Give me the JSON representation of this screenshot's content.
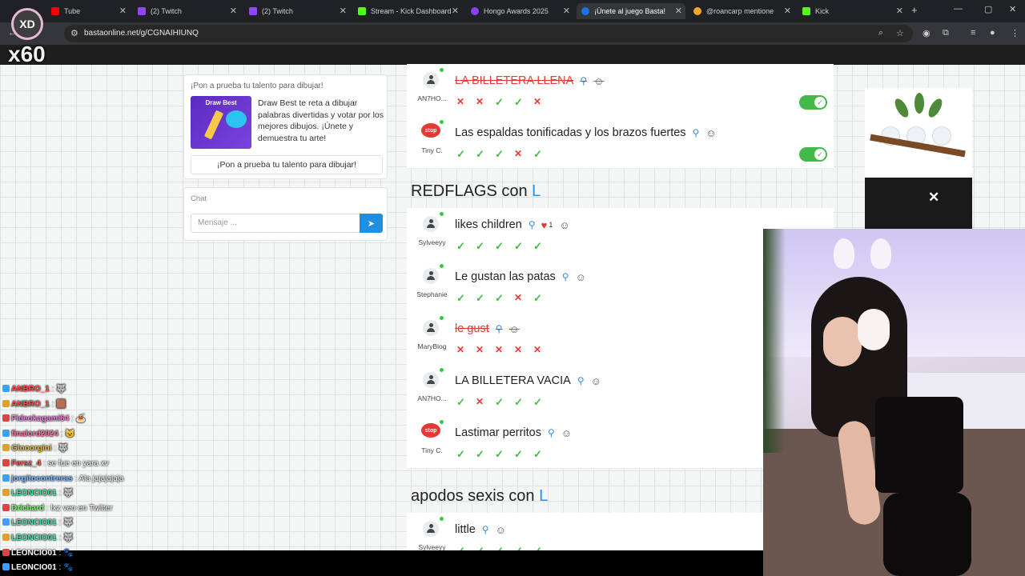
{
  "browser": {
    "tabs": [
      {
        "label": "Tube",
        "icon": "youtube-icon"
      },
      {
        "label": "(2) Twitch",
        "icon": "twitch-icon"
      },
      {
        "label": "(2) Twitch",
        "icon": "twitch-icon"
      },
      {
        "label": "Stream - Kick Dashboard",
        "icon": "kick-icon"
      },
      {
        "label": "Hongo Awards 2025",
        "icon": "hongo-icon"
      },
      {
        "label": "¡Únete al juego Basta!",
        "icon": "basta-icon"
      },
      {
        "label": "@roancarp mentione",
        "icon": "bell-icon"
      },
      {
        "label": "Kick",
        "icon": "kick-icon"
      }
    ],
    "url": "bastaonline.net/g/CGNAIHIUNQ"
  },
  "promo": {
    "title": "¡Pon a prueba tu talento para dibujar!",
    "image_caption": "Draw Best",
    "text": "Draw Best te reta a dibujar palabras divertidas y votar por los mejores dibujos. ¡Únete y demuestra tu arte!",
    "button": "¡Pon a prueba tu talento para dibujar!"
  },
  "chat": {
    "title": "Chat",
    "placeholder": "Mensaje ..."
  },
  "top_answers": [
    {
      "user": "AN7HO...",
      "avatar": "person",
      "text": "LA BILLETERA LLENA",
      "rejected": true,
      "votes": [
        "no",
        "no",
        "ok",
        "ok",
        "no"
      ],
      "toggle": "on"
    },
    {
      "user": "Tiny C.",
      "avatar": "stop",
      "text": "Las espaldas tonificadas y los brazos fuertes",
      "rejected": false,
      "votes": [
        "ok",
        "ok",
        "ok",
        "no",
        "ok"
      ],
      "toggle": "on"
    }
  ],
  "sections": [
    {
      "title": "REDFLAGS con",
      "letter": "L",
      "answers": [
        {
          "user": "Sylveeyy",
          "avatar": "person",
          "text": "likes children",
          "rejected": false,
          "hearts": "1",
          "votes": [
            "ok",
            "ok",
            "ok",
            "ok",
            "ok"
          ]
        },
        {
          "user": "Stephanie",
          "avatar": "person",
          "text": "Le gustan las patas",
          "rejected": false,
          "votes": [
            "ok",
            "ok",
            "ok",
            "no",
            "ok"
          ]
        },
        {
          "user": "MaryBlog",
          "avatar": "person",
          "text": "le gust",
          "rejected": true,
          "votes": [
            "no",
            "no",
            "no",
            "no",
            "no"
          ]
        },
        {
          "user": "AN7HO...",
          "avatar": "person",
          "text": "LA BILLETERA VACIA",
          "rejected": false,
          "votes": [
            "ok",
            "no",
            "ok",
            "ok",
            "ok"
          ]
        },
        {
          "user": "Tiny C.",
          "avatar": "stop",
          "text": "Lastimar perritos",
          "rejected": false,
          "votes": [
            "ok",
            "ok",
            "ok",
            "ok",
            "ok"
          ]
        }
      ]
    },
    {
      "title": "apodos sexis con",
      "letter": "L",
      "answers": [
        {
          "user": "Sylveeyy",
          "avatar": "person",
          "text": "little",
          "rejected": false,
          "votes": [
            "ok",
            "ok",
            "ok",
            "ok",
            "ok"
          ]
        }
      ]
    }
  ],
  "stream_overlay": {
    "logo_text": "XD",
    "multiplier": "x60",
    "chat_lines": [
      {
        "user": "ANBRO_1",
        "color": "#ff4d4d",
        "msg": ": 🐺"
      },
      {
        "user": "ANBRO_1",
        "color": "#ff4d4d",
        "msg": ": 🟫"
      },
      {
        "user": "Fideokagami64",
        "color": "#ff7ad9",
        "msg": ": 🍝"
      },
      {
        "user": "finalord2024",
        "color": "#ff6fa0",
        "msg": ": 😺"
      },
      {
        "user": "Glooorgini",
        "color": "#e0c04a",
        "msg": ": 🐺"
      },
      {
        "user": "Fersz_4",
        "color": "#ff5050",
        "msg": ": se fue en yara xv"
      },
      {
        "user": "jorgitocontreras",
        "color": "#7ab8ff",
        "msg": ": Ala jajajajaja"
      },
      {
        "user": "LEONCIO01",
        "color": "#4de0a6",
        "msg": ": 🐺"
      },
      {
        "user": "Drichard",
        "color": "#7aff6a",
        "msg": ": lxz veo en Twitter"
      },
      {
        "user": "LEONCIO01",
        "color": "#4de0a6",
        "msg": ": 🐺"
      },
      {
        "user": "LEONCIO01",
        "color": "#4de0a6",
        "msg": ": 🐺"
      },
      {
        "user": "LEONCIO01",
        "color": "#ffffff",
        "msg": ": 🐾"
      },
      {
        "user": "LEONCIO01",
        "color": "#ffffff",
        "msg": ": 🐾"
      }
    ]
  },
  "colors": {
    "accent": "#2a93e0",
    "ok": "#43b94a",
    "no": "#e53935",
    "send": "#1e8fe1"
  }
}
